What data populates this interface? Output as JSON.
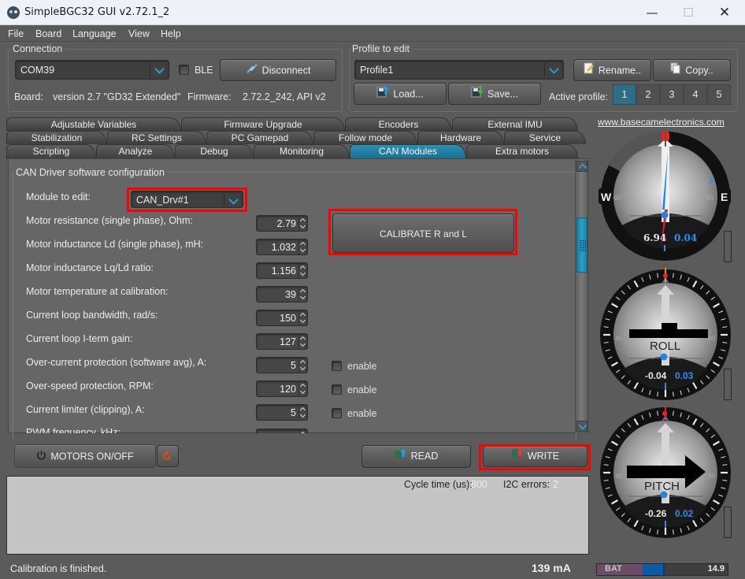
{
  "window": {
    "title": "SimpleBGC32 GUI v2.72.1_2",
    "controls": {
      "minimize": "—",
      "maximize": "☐",
      "close": "✕"
    }
  },
  "menu": [
    "File",
    "Board",
    "Language",
    "View",
    "Help"
  ],
  "connection": {
    "group_title": "Connection",
    "port": "COM39",
    "ble_label": "BLE",
    "ble_checked": false,
    "disconnect_label": "Disconnect",
    "board_label": "Board:",
    "board_value": "version 2.7 \"GD32 Extended\"",
    "firmware_label": "Firmware:",
    "firmware_value": "2.72.2_242, API v2"
  },
  "profile": {
    "group_title": "Profile to edit",
    "selected": "Profile1",
    "rename_label": "Rename..",
    "copy_label": "Copy..",
    "load_label": "Load...",
    "save_label": "Save...",
    "active_label": "Active profile:",
    "numbers": [
      "1",
      "2",
      "3",
      "4",
      "5"
    ],
    "active": "1"
  },
  "tabs": {
    "row1": [
      "Adjustable Variables",
      "Firmware Upgrade",
      "Encoders",
      "External IMU"
    ],
    "row2": [
      "Stabilization",
      "RC Settings",
      "PC Gamepad",
      "Follow mode",
      "Hardware",
      "Service"
    ],
    "row3": [
      "Scripting",
      "Analyze",
      "Debug",
      "Monitoring",
      "CAN Modules",
      "Extra motors"
    ],
    "active": "CAN Modules"
  },
  "can": {
    "group_title": "CAN Driver software configuration",
    "module_label": "Module to edit:",
    "module_value": "CAN_Drv#1",
    "calibrate_label": "CALIBRATE R and L",
    "enable_label": "enable",
    "params": [
      {
        "label": "Motor resistance (single phase), Ohm:",
        "value": "2.79"
      },
      {
        "label": "Motor inductance Ld (single phase), mH:",
        "value": "1.032"
      },
      {
        "label": "Motor inductance Lq/Ld ratio:",
        "value": "1.156"
      },
      {
        "label": "Motor temperature at calibration:",
        "value": "39"
      },
      {
        "label": "Current loop bandwidth, rad/s:",
        "value": "150"
      },
      {
        "label": "Current loop I-term gain:",
        "value": "127"
      },
      {
        "label": "Over-current protection (software avg), A:",
        "value": "5",
        "enable": false
      },
      {
        "label": "Over-speed protection, RPM:",
        "value": "120",
        "enable": false
      },
      {
        "label": "Current limiter (clipping), A:",
        "value": "5",
        "enable": false
      },
      {
        "label": "PWM frequency, kHz:",
        "value": ""
      }
    ]
  },
  "bottom": {
    "motors_label": "MOTORS ON/OFF",
    "read_label": "READ",
    "write_label": "WRITE",
    "cycle_label": "Cycle time (us):",
    "cycle_value": "800",
    "i2c_label": "I2C errors:",
    "i2c_value": "2"
  },
  "statusbar": {
    "message": "Calibration is finished.",
    "current": "139 mA",
    "bat_label": "BAT",
    "bat_value": "14.9"
  },
  "side": {
    "link": "www.basecamelectronics.com",
    "yaw": {
      "compass_w": "W",
      "compass_e": "E",
      "minus90": "-90",
      "plus90": "90",
      "angle": "6.94",
      "rate": "0.04"
    },
    "roll": {
      "name": "ROLL",
      "minus90": "-90",
      "plus90": "90",
      "angle": "-0.04",
      "rate": "0.03"
    },
    "pitch": {
      "name": "PITCH",
      "minus90": "-90",
      "plus90": "90",
      "angle": "-0.26",
      "rate": "0.02"
    }
  },
  "colors": {
    "accent": "#2c9bd1",
    "tab_active": "#1f7da2",
    "highlight": "#ff0000",
    "bat_fill": "#0d5aa5"
  }
}
